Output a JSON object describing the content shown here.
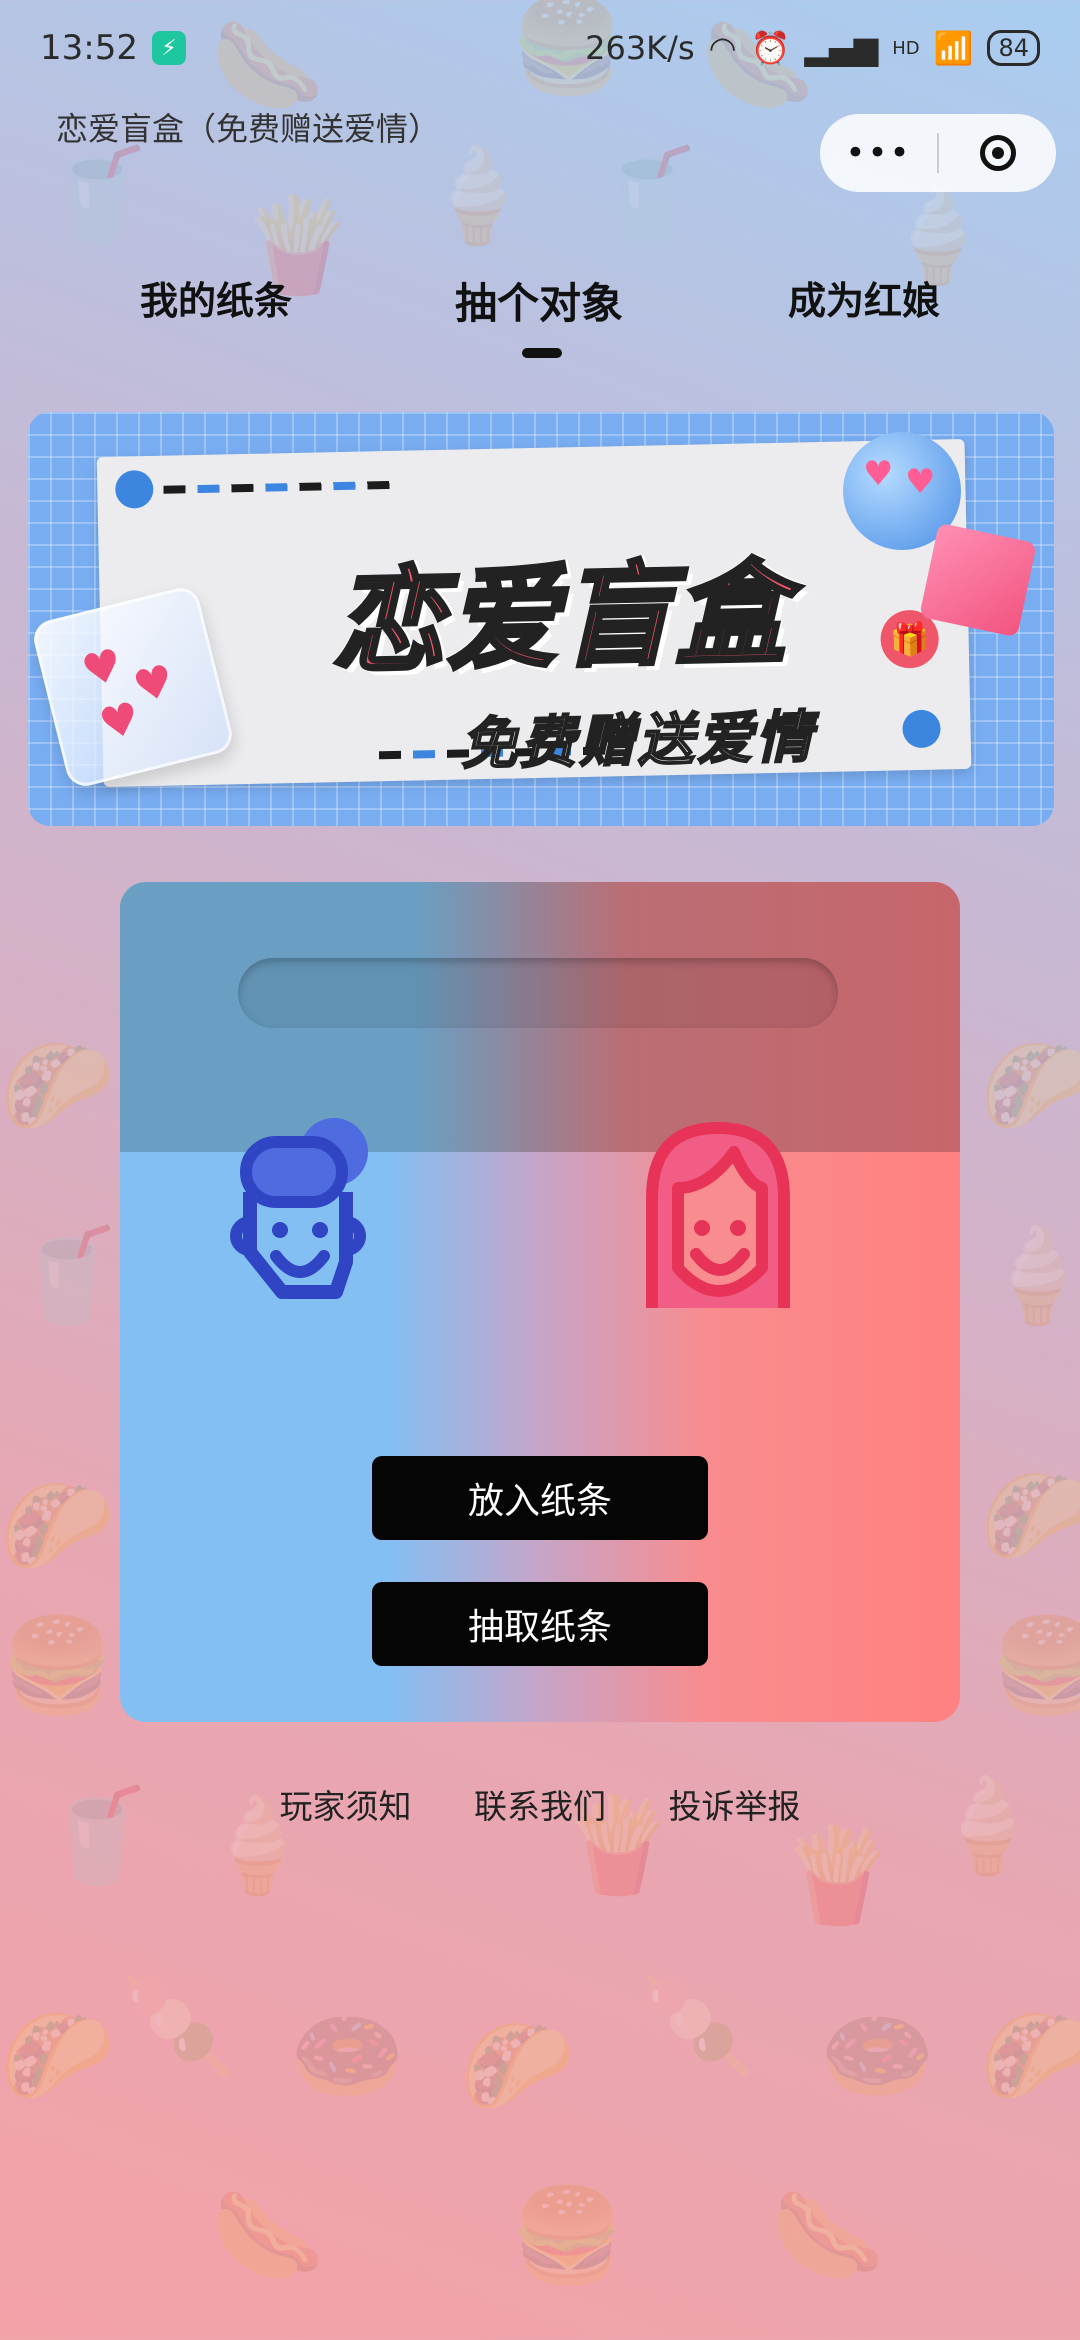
{
  "status_bar": {
    "time": "13:52",
    "net_speed": "263K/s",
    "signal_1": "▂▄▆",
    "signal_label": "HD",
    "battery": "84"
  },
  "app": {
    "title": "恋爱盲盒（免费赠送爱情）",
    "capsule_more": "•••"
  },
  "tabs": [
    {
      "label": "我的纸条",
      "active": false
    },
    {
      "label": "抽个对象",
      "active": true
    },
    {
      "label": "成为红娘",
      "active": false
    }
  ],
  "banner": {
    "title": "恋爱盲盒",
    "subtitle": "免费赠送爱情"
  },
  "box": {
    "put_button": "放入纸条",
    "draw_button": "抽取纸条",
    "boy_color": "#2f45c4",
    "girl_color": "#e83358"
  },
  "footer": {
    "links": [
      "玩家须知",
      "联系我们",
      "投诉举报"
    ]
  },
  "colors": {
    "accent_red": "#f0566a",
    "accent_blue": "#3d86e0"
  }
}
